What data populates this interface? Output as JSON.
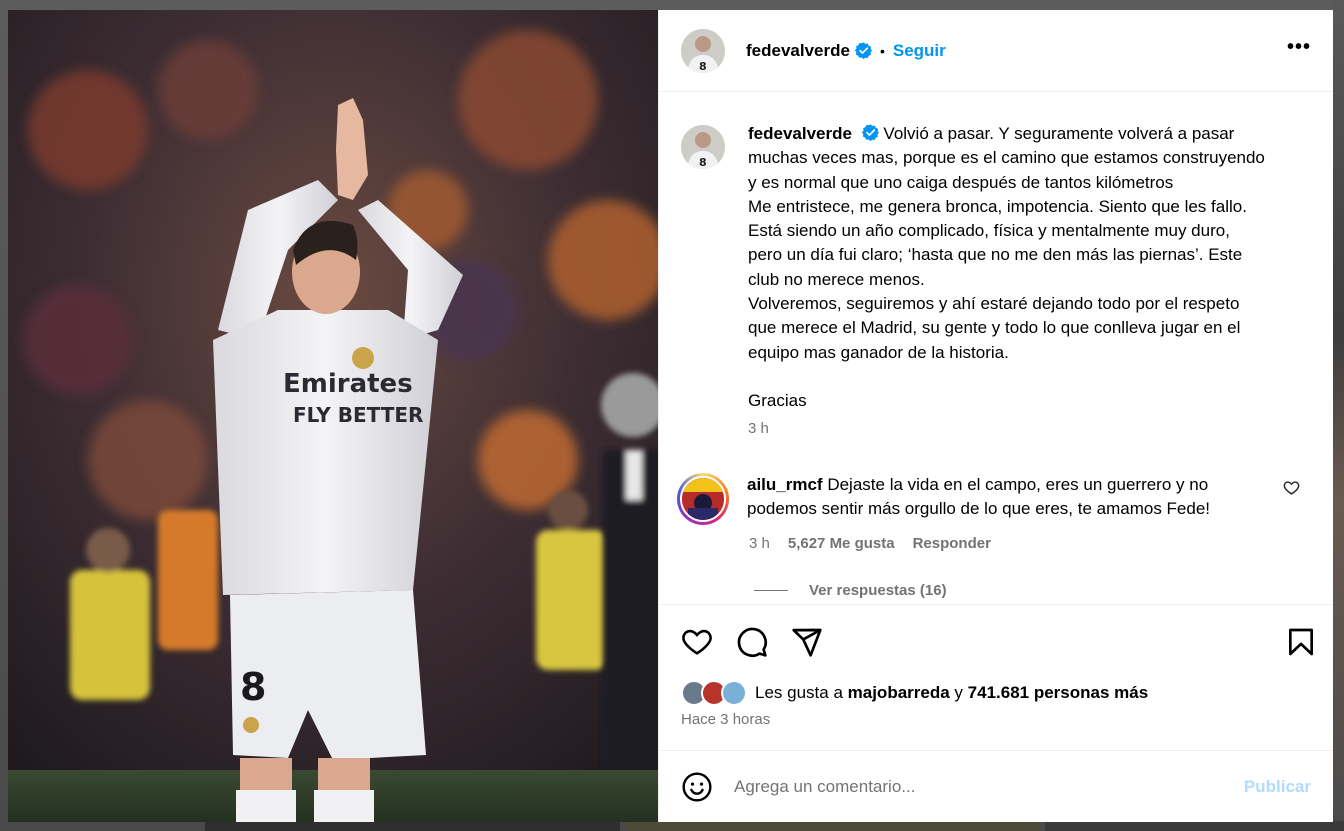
{
  "post": {
    "username": "fedevalverde",
    "follow_label": "Seguir",
    "separator": "•",
    "more_label": "•••"
  },
  "caption": {
    "username": "fedevalverde",
    "lines": [
      "Volvió a pasar. Y seguramente volverá a pasar",
      "muchas veces mas, porque es el camino que estamos construyendo",
      "y es normal que uno caiga después de tantos kilómetros",
      "Me entristece, me genera bronca, impotencia. Siento que les fallo.",
      "Está siendo un año complicado, física y mentalmente muy duro,",
      "pero un día fui claro; ‘hasta que no me den más las piernas’. Este",
      "club no merece menos.",
      "Volveremos, seguiremos y ahí estaré dejando todo por el respeto",
      "que merece el Madrid, su gente y todo lo que conlleva jugar en el",
      "equipo mas ganador de la historia."
    ],
    "closing": "Gracias",
    "time": "3 h"
  },
  "comment": {
    "username": "ailu_rmcf",
    "text_line1": "Dejaste la vida en el campo, eres un guerrero y no",
    "text_line2": "podemos sentir más orgullo de lo que eres, te amamos Fede!",
    "time": "3 h",
    "likes": "5,627 Me gusta",
    "reply_label": "Responder",
    "view_replies": "Ver respuestas (16)"
  },
  "likes": {
    "prefix": "Les gusta a",
    "user": "majobarreda",
    "conj": "y",
    "others": "741.681 personas más"
  },
  "posted_ago": "Hace 3 horas",
  "composer": {
    "placeholder": "Agrega un comentario...",
    "publish_label": "Publicar"
  },
  "colors": {
    "accent": "#0095f6",
    "publish_disabled": "#b3dbff",
    "muted": "#737373"
  },
  "icons": [
    "verified-badge-icon",
    "more-options-icon",
    "heart-icon",
    "comment-icon",
    "share-icon",
    "bookmark-icon",
    "emoji-icon"
  ]
}
